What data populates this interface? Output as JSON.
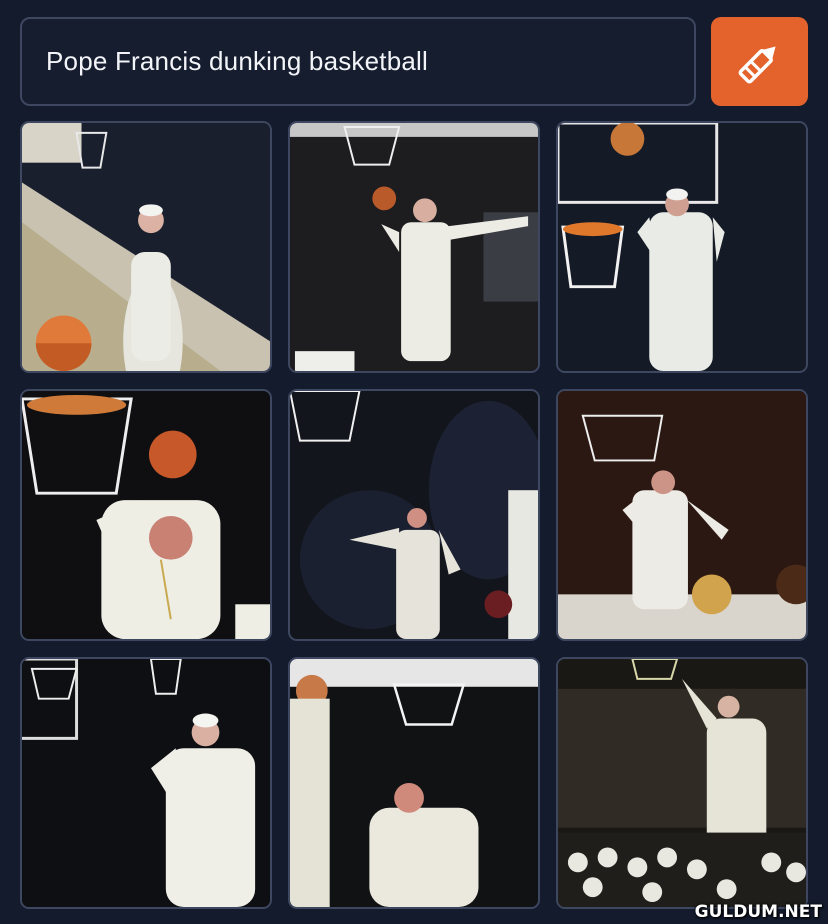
{
  "prompt": {
    "text": "Pope Francis dunking basketball"
  },
  "generate_button": {
    "icon": "crayon-icon",
    "color": "#e4632c"
  },
  "watermark": {
    "text": "GULDUM.NET"
  },
  "images": [
    {
      "icon": "generated-image"
    },
    {
      "icon": "generated-image"
    },
    {
      "icon": "generated-image"
    },
    {
      "icon": "generated-image"
    },
    {
      "icon": "generated-image"
    },
    {
      "icon": "generated-image"
    },
    {
      "icon": "generated-image"
    },
    {
      "icon": "generated-image"
    },
    {
      "icon": "generated-image"
    }
  ]
}
